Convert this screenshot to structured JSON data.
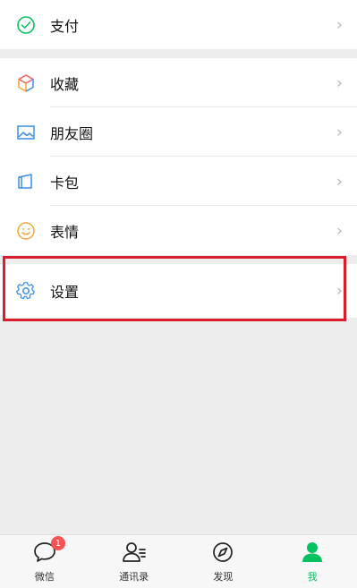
{
  "menu_group1": [
    {
      "label": "支付",
      "icon": "pay-icon"
    }
  ],
  "menu_group2": [
    {
      "label": "收藏",
      "icon": "favorites-cube-icon"
    },
    {
      "label": "朋友圈",
      "icon": "moments-image-icon"
    },
    {
      "label": "卡包",
      "icon": "card-wallet-icon"
    },
    {
      "label": "表情",
      "icon": "sticker-smile-icon"
    }
  ],
  "menu_group3": [
    {
      "label": "设置",
      "icon": "settings-gear-icon"
    }
  ],
  "tabbar": {
    "items": [
      {
        "label": "微信",
        "icon": "chat-bubble-icon",
        "badge": "1"
      },
      {
        "label": "通讯录",
        "icon": "contacts-icon"
      },
      {
        "label": "发现",
        "icon": "compass-icon"
      },
      {
        "label": "我",
        "icon": "me-person-icon"
      }
    ]
  },
  "colors": {
    "accent": "#07c160",
    "highlight_border": "#d81e2a",
    "badge": "#fa5151"
  }
}
